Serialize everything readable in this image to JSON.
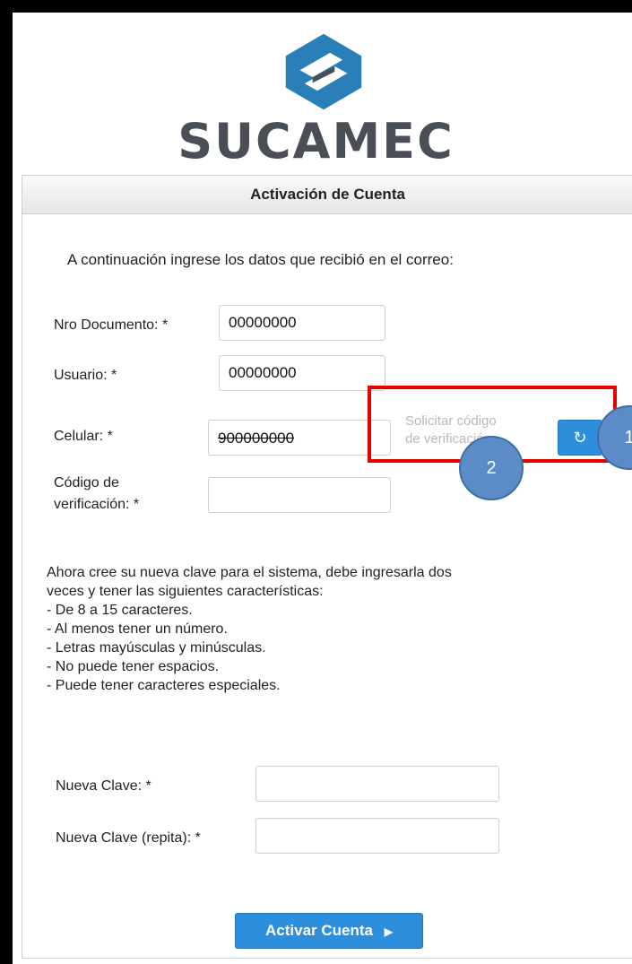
{
  "brand": {
    "name": "SUCAMEC"
  },
  "panel": {
    "title": "Activación de Cuenta"
  },
  "intro": "A continuación ingrese los datos que recibió en el correo:",
  "fields": {
    "document": {
      "label": "Nro Documento: *",
      "value": "00000000"
    },
    "user": {
      "label": "Usuario: *",
      "value": "00000000"
    },
    "phone": {
      "label": "Celular: *",
      "value": "900000000"
    },
    "code": {
      "label_line1": "Código de",
      "label_line2": "verificación: *",
      "value": ""
    },
    "new_password": {
      "label": "Nueva Clave: *",
      "value": ""
    },
    "new_password_repeat": {
      "label": "Nueva Clave (repita): *",
      "value": ""
    }
  },
  "request_code": {
    "line1": "Solicitar código",
    "line2": "de verificación",
    "icon": "refresh-icon"
  },
  "annotations": {
    "badge1": "1",
    "badge2": "2"
  },
  "password_rules": {
    "line1": "Ahora cree su nueva clave para el sistema, debe ingresarla dos",
    "line2": "veces y tener las siguientes características:",
    "items": [
      "- De 8 a 15 caracteres.",
      "- Al menos tener un número.",
      "- Letras mayúsculas y minúsculas.",
      "- No puede tener espacios.",
      "- Puede tener caracteres especiales."
    ]
  },
  "activate_button": {
    "label": "Activar Cuenta",
    "icon": "chevron-right-icon"
  },
  "colors": {
    "primary": "#2d8fdc",
    "highlight": "#e60000",
    "badge": "#5b8cc8",
    "logo": "#2a7fb8"
  }
}
